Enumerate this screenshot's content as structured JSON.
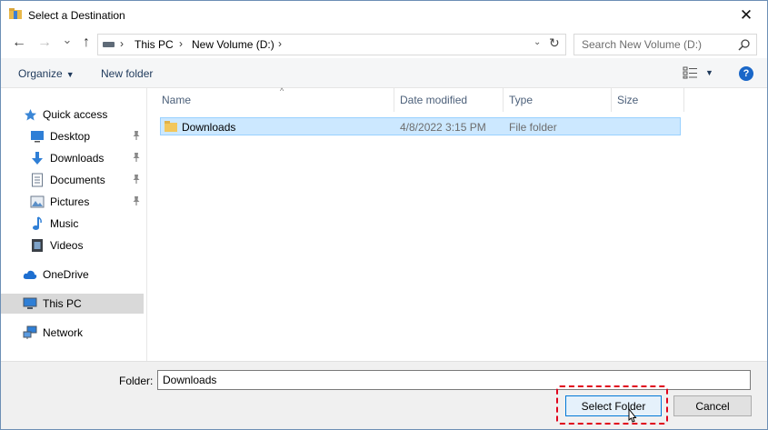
{
  "window": {
    "title": "Select a Destination",
    "close_glyph": "✕"
  },
  "nav": {
    "back_glyph": "←",
    "forward_glyph": "→",
    "recent_glyph": "⌄",
    "up_glyph": "↑",
    "breadcrumbs": [
      "This PC",
      "New Volume (D:)"
    ],
    "crumb_sep": "›",
    "dropdown_glyph": "⌄",
    "refresh_glyph": "↻",
    "search_placeholder": "Search New Volume (D:)"
  },
  "toolbar": {
    "organize_label": "Organize",
    "organize_caret": "▼",
    "new_folder_label": "New folder",
    "view_caret": "▼",
    "help_label": "?"
  },
  "sidebar": {
    "pin_glyph": "📌",
    "quick_access": "Quick access",
    "items": [
      {
        "label": "Desktop",
        "icon": "desktop-icon",
        "pinned": true
      },
      {
        "label": "Downloads",
        "icon": "download-icon",
        "pinned": true
      },
      {
        "label": "Documents",
        "icon": "document-icon",
        "pinned": true
      },
      {
        "label": "Pictures",
        "icon": "picture-icon",
        "pinned": true
      },
      {
        "label": "Music",
        "icon": "music-icon",
        "pinned": false
      },
      {
        "label": "Videos",
        "icon": "video-icon",
        "pinned": false
      }
    ],
    "onedrive": "OneDrive",
    "this_pc": "This PC",
    "network": "Network"
  },
  "columns": {
    "name": "Name",
    "date": "Date modified",
    "type": "Type",
    "size": "Size",
    "sort_glyph": "^"
  },
  "files": [
    {
      "name": "Downloads",
      "date": "4/8/2022 3:15 PM",
      "type": "File folder",
      "size": ""
    }
  ],
  "footer": {
    "folder_label": "Folder:",
    "folder_value": "Downloads",
    "select_label": "Select Folder",
    "cancel_label": "Cancel"
  },
  "colors": {
    "accent": "#0078d7",
    "selection": "#cce8ff",
    "highlight_border": "#e0001b"
  }
}
